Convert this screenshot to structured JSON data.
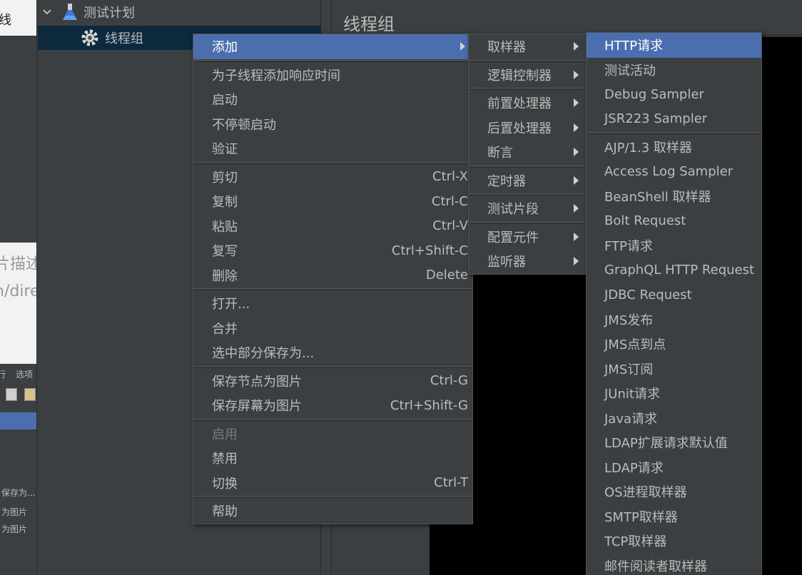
{
  "background": {
    "left_strip": {
      "top_text": "线",
      "mid_text1": "片描述",
      "mid_text2": "n/dire",
      "toolbar_text1": "行",
      "toolbar_text2": "选项",
      "list": [
        "保存为...",
        "为图片",
        "为图片"
      ]
    },
    "tree": {
      "root": "测试计划",
      "thread_group": "线程组"
    },
    "panel_title": "线程组"
  },
  "context_menu": {
    "groups": [
      [
        {
          "label": "添加",
          "submenu": true,
          "selected": true
        }
      ],
      [
        {
          "label": "为子线程添加响应时间"
        },
        {
          "label": "启动"
        },
        {
          "label": "不停顿启动"
        },
        {
          "label": "验证"
        }
      ],
      [
        {
          "label": "剪切",
          "shortcut": "Ctrl-X"
        },
        {
          "label": "复制",
          "shortcut": "Ctrl-C"
        },
        {
          "label": "粘贴",
          "shortcut": "Ctrl-V"
        },
        {
          "label": "复写",
          "shortcut": "Ctrl+Shift-C"
        },
        {
          "label": "删除",
          "shortcut": "Delete"
        }
      ],
      [
        {
          "label": "打开..."
        },
        {
          "label": "合并"
        },
        {
          "label": "选中部分保存为..."
        }
      ],
      [
        {
          "label": "保存节点为图片",
          "shortcut": "Ctrl-G"
        },
        {
          "label": "保存屏幕为图片",
          "shortcut": "Ctrl+Shift-G"
        }
      ],
      [
        {
          "label": "启用",
          "disabled": true
        },
        {
          "label": "禁用"
        },
        {
          "label": "切换",
          "shortcut": "Ctrl-T"
        }
      ],
      [
        {
          "label": "帮助"
        }
      ]
    ]
  },
  "add_menu": {
    "groups": [
      [
        {
          "label": "取样器",
          "submenu": true
        }
      ],
      [
        {
          "label": "逻辑控制器",
          "submenu": true
        }
      ],
      [
        {
          "label": "前置处理器",
          "submenu": true
        },
        {
          "label": "后置处理器",
          "submenu": true
        },
        {
          "label": "断言",
          "submenu": true
        }
      ],
      [
        {
          "label": "定时器",
          "submenu": true
        }
      ],
      [
        {
          "label": "测试片段",
          "submenu": true
        }
      ],
      [
        {
          "label": "配置元件",
          "submenu": true
        },
        {
          "label": "监听器",
          "submenu": true
        }
      ]
    ]
  },
  "sampler_menu": {
    "groups": [
      [
        {
          "label": "HTTP请求",
          "selected": true
        },
        {
          "label": "测试活动"
        },
        {
          "label": "Debug Sampler"
        },
        {
          "label": "JSR223 Sampler"
        }
      ],
      [
        {
          "label": "AJP/1.3 取样器"
        },
        {
          "label": "Access Log Sampler"
        },
        {
          "label": "BeanShell 取样器"
        },
        {
          "label": "Bolt Request"
        },
        {
          "label": "FTP请求"
        },
        {
          "label": "GraphQL HTTP Request"
        },
        {
          "label": "JDBC Request"
        },
        {
          "label": "JMS发布"
        },
        {
          "label": "JMS点到点"
        },
        {
          "label": "JMS订阅"
        },
        {
          "label": "JUnit请求"
        },
        {
          "label": "Java请求"
        },
        {
          "label": "LDAP扩展请求默认值"
        },
        {
          "label": "LDAP请求"
        },
        {
          "label": "OS进程取样器"
        },
        {
          "label": "SMTP取样器"
        },
        {
          "label": "TCP取样器"
        },
        {
          "label": "邮件阅读者取样器"
        }
      ]
    ]
  },
  "colors": {
    "selection": "#4b6eaf",
    "menu_bg": "#3c3f41",
    "tree_selected": "#0d293e",
    "text": "#bbbbbb",
    "disabled_text": "#787878"
  }
}
